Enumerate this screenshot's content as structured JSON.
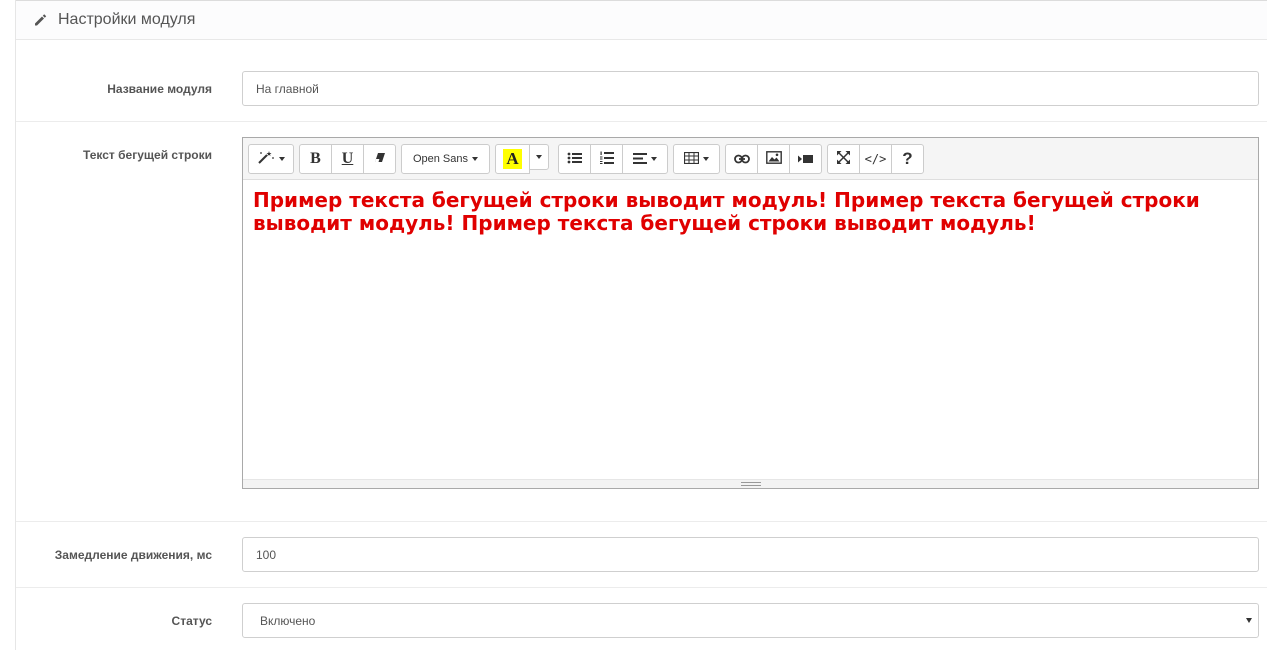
{
  "panel": {
    "title": "Настройки модуля",
    "icon": "pencil-icon"
  },
  "fields": {
    "name": {
      "label": "Название модуля",
      "value": "На главной"
    },
    "text": {
      "label": "Текст бегущей строки",
      "content": "Пример текста бегущей строки выводит модуль! Пример текста бегущей строки выводит модуль! Пример текста бегущей строки выводит модуль!",
      "content_color": "#e00000"
    },
    "delay": {
      "label": "Замедление движения, мс",
      "value": "100"
    },
    "status": {
      "label": "Статус",
      "selected": "Включено"
    }
  },
  "editor_toolbar": {
    "style_icon": "magic-wand-icon",
    "bold": "B",
    "underline": "U",
    "eraser_icon": "eraser-icon",
    "font_name": "Open Sans",
    "color_letter": "A",
    "highlight_color": "#ffff00",
    "ul_icon": "unordered-list-icon",
    "ol_icon": "ordered-list-icon",
    "align_icon": "align-icon",
    "table_icon": "table-icon",
    "link_icon": "link-icon",
    "picture_icon": "picture-icon",
    "video_icon": "video-icon",
    "fullscreen_icon": "fullscreen-icon",
    "codeview_label": "</>",
    "help_label": "?"
  }
}
